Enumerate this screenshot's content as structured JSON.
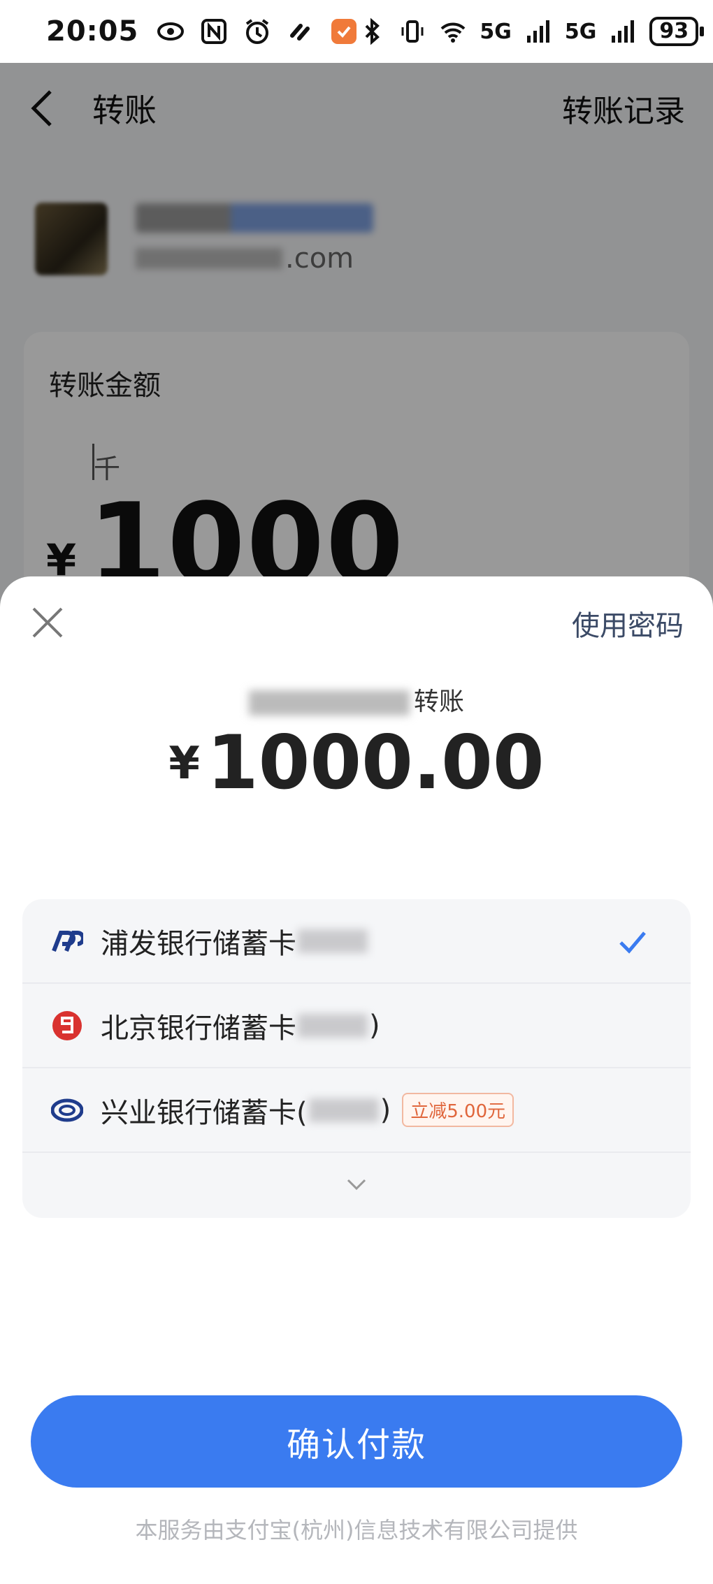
{
  "status_bar": {
    "time": "20:05",
    "battery": "93",
    "network_labels": [
      "5G",
      "5G"
    ]
  },
  "nav": {
    "title": "转账",
    "records_link": "转账记录"
  },
  "payee": {
    "account_suffix": ".com"
  },
  "amount_card": {
    "label": "转账金额",
    "unit_hint": "千",
    "currency": "¥",
    "value": "1000"
  },
  "sheet": {
    "use_password": "使用密码",
    "description_suffix": "转账",
    "currency": "¥",
    "amount": "1000.00",
    "cards": [
      {
        "label": "浦发银行储蓄卡",
        "icon": "spdb-bank-icon",
        "selected": true
      },
      {
        "label": "北京银行储蓄卡",
        "close": ")",
        "icon": "bank-of-beijing-icon",
        "selected": false
      },
      {
        "label": "兴业银行储蓄卡(",
        "close": ")",
        "icon": "cib-bank-icon",
        "selected": false,
        "promo": "立减5.00元"
      }
    ],
    "confirm_button": "确认付款",
    "footer": "本服务由支付宝(杭州)信息技术有限公司提供"
  },
  "colors": {
    "primary_button": "#3a7bf0",
    "promo": "#e0663c",
    "check": "#3a7bf0"
  }
}
